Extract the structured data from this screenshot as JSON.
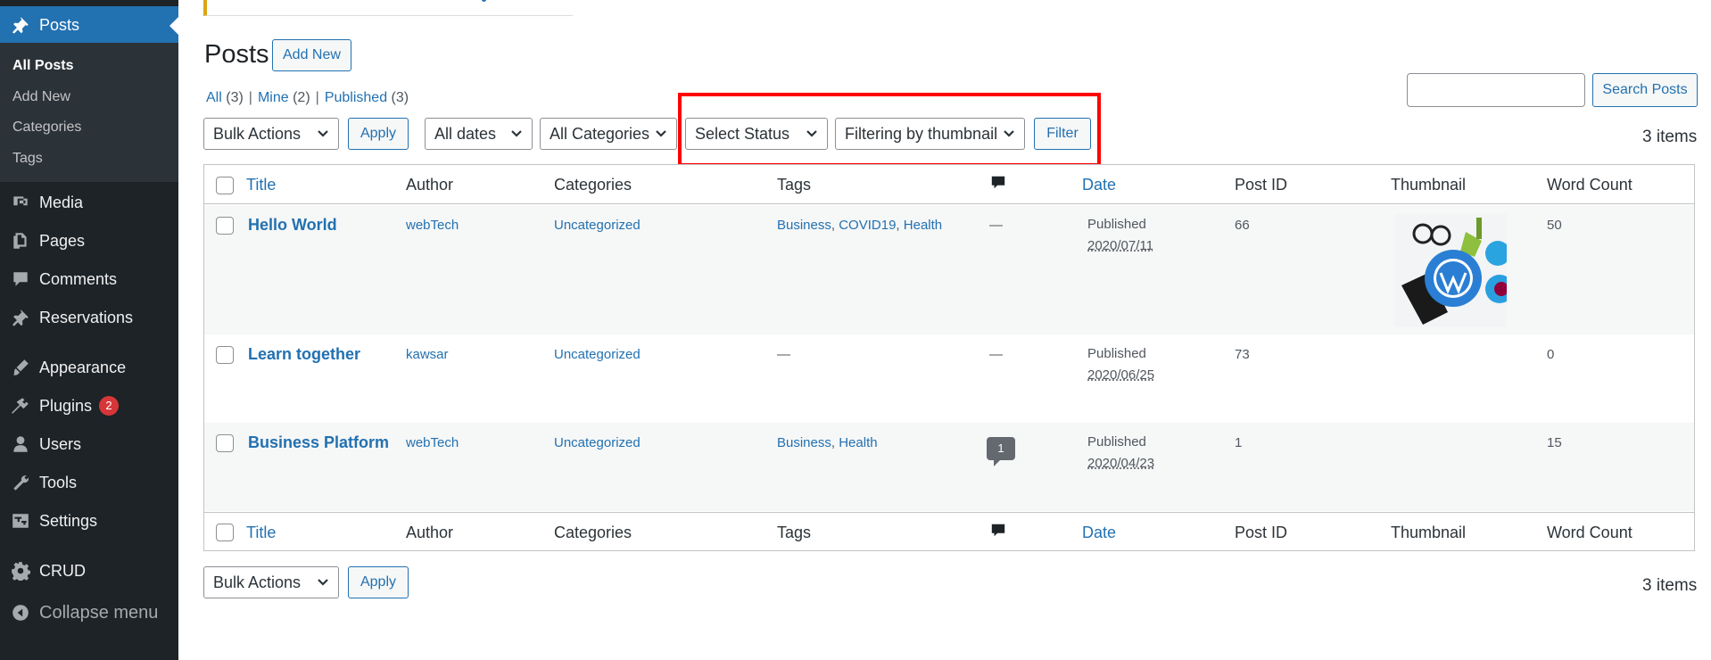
{
  "sidebar": {
    "current_label": "Posts",
    "submenu": [
      "All Posts",
      "Add New",
      "Categories",
      "Tags"
    ],
    "items": [
      {
        "label": "Media",
        "icon": "media-icon"
      },
      {
        "label": "Pages",
        "icon": "pages-icon"
      },
      {
        "label": "Comments",
        "icon": "comments-icon"
      },
      {
        "label": "Reservations",
        "icon": "pin-icon"
      },
      {
        "label": "Appearance",
        "icon": "appearance-icon"
      },
      {
        "label": "Plugins",
        "icon": "plugins-icon",
        "badge": "2"
      },
      {
        "label": "Users",
        "icon": "users-icon"
      },
      {
        "label": "Tools",
        "icon": "tools-icon"
      },
      {
        "label": "Settings",
        "icon": "settings-icon"
      },
      {
        "label": "CRUD",
        "icon": "gear-icon"
      },
      {
        "label": "Collapse menu",
        "icon": "collapse-icon"
      }
    ]
  },
  "header": {
    "title": "Posts",
    "add_new": "Add New"
  },
  "views": {
    "all": "All",
    "all_count": "(3)",
    "mine": "Mine",
    "mine_count": "(2)",
    "published": "Published",
    "published_count": "(3)",
    "sep": "|"
  },
  "search": {
    "button": "Search Posts",
    "value": ""
  },
  "filters": {
    "bulk_actions": "Bulk Actions",
    "apply": "Apply",
    "dates": "All dates",
    "categories": "All Categories",
    "status": "Select Status",
    "thumbnail": "Filtering by thumbnail",
    "filter": "Filter"
  },
  "items_count": "3 items",
  "columns": {
    "title": "Title",
    "author": "Author",
    "categories": "Categories",
    "tags": "Tags",
    "date": "Date",
    "post_id": "Post ID",
    "thumbnail": "Thumbnail",
    "word_count": "Word Count"
  },
  "rows": [
    {
      "title": "Hello World",
      "author": "webTech",
      "category": "Uncategorized",
      "tags": [
        "Business",
        "COVID19",
        "Health"
      ],
      "comments": "—",
      "status": "Published",
      "date": "2020/07/11",
      "post_id": "66",
      "has_thumbnail": true,
      "word_count": "50"
    },
    {
      "title": "Learn together",
      "author": "kawsar",
      "category": "Uncategorized",
      "tags": [],
      "tags_empty": "—",
      "comments": "—",
      "status": "Published",
      "date": "2020/06/25",
      "post_id": "73",
      "has_thumbnail": false,
      "word_count": "0"
    },
    {
      "title": "Business Platform",
      "author": "webTech",
      "category": "Uncategorized",
      "tags": [
        "Business",
        "Health"
      ],
      "comments": "1",
      "status": "Published",
      "date": "2020/04/23",
      "post_id": "1",
      "has_thumbnail": false,
      "word_count": "15"
    }
  ],
  "tag_separator": ", ",
  "colors": {
    "accent": "#2271b1",
    "sidebar": "#1d2327",
    "highlight": "#ff0000",
    "badge": "#d63638"
  }
}
